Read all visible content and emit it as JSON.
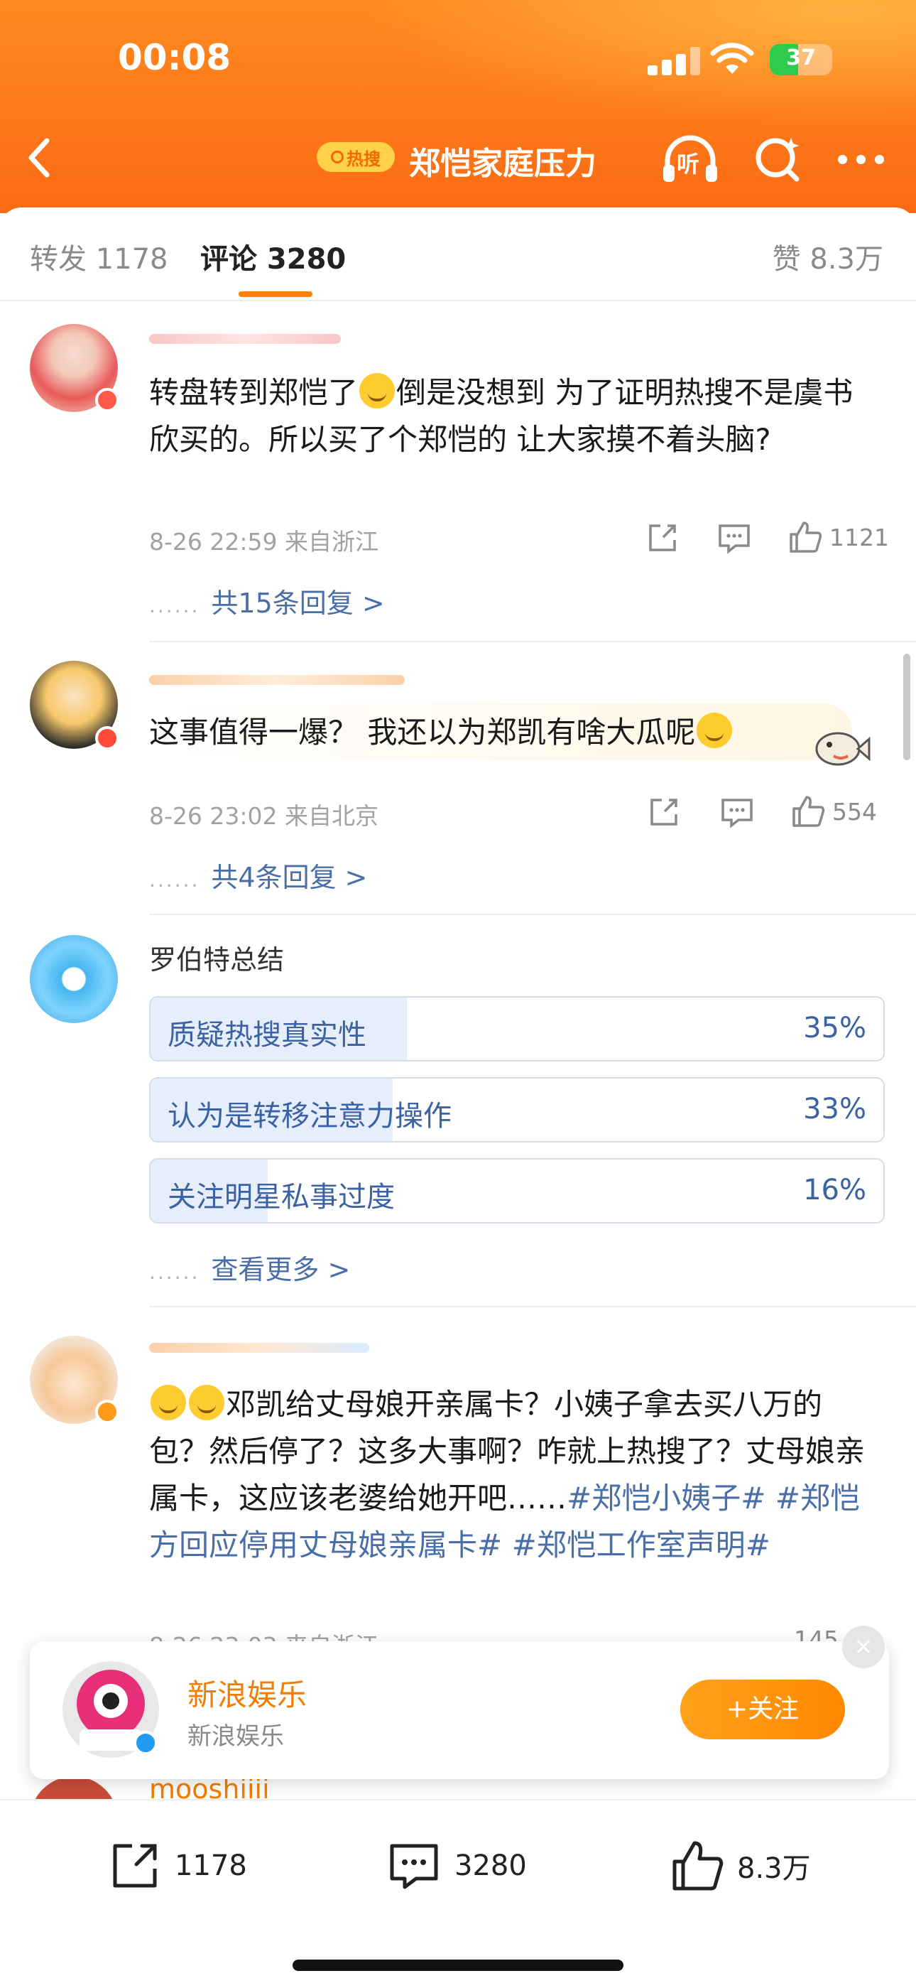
{
  "status_bar": {
    "time": "00:08",
    "battery": "37"
  },
  "header": {
    "hot_label": "热搜",
    "title": "郑恺家庭压力",
    "listen_label": "听"
  },
  "tabs": {
    "repost": "转发 1178",
    "comment": "评论 3280",
    "like": "赞 8.3万"
  },
  "comments": [
    {
      "text": "转盘转到郑恺了",
      "text_after_emoji": "倒是没想到 为了证明热搜不是虞书欣买的。所以买了个郑恺的 让大家摸不着头脑?",
      "meta": "8-26 22:59  来自浙江",
      "likes": "1121",
      "replies": "共15条回复 >"
    },
    {
      "text": "这事值得一爆？ 我还以为郑凯有啥大瓜呢",
      "meta": "8-26 23:02  来自北京",
      "likes": "554",
      "replies": "共4条回复 >"
    }
  ],
  "poll": {
    "name": "罗伯特总结",
    "options": [
      {
        "label": "质疑热搜真实性",
        "percent": "35%",
        "fill": 0.35
      },
      {
        "label": "认为是转移注意力操作",
        "percent": "33%",
        "fill": 0.33
      },
      {
        "label": "关注明星私事过度",
        "percent": "16%",
        "fill": 0.16
      }
    ],
    "more": "查看更多 >"
  },
  "comment3": {
    "text_part1": "邓凯给丈母娘开亲属卡？小姨子拿去买八万的包？然后停了？这多大事啊？咋就上热搜了？丈母娘亲属卡，这应该老婆给她开吧……",
    "hashtag1": "#郑恺小姨子#",
    "hashtag2": "#郑恺方回应停用丈母娘亲属卡#",
    "hashtag3": "#郑恺工作室声明#",
    "meta": "8-26 23:03  来自浙江",
    "likes": "145"
  },
  "next_user": "mooshiiii",
  "float_card": {
    "title": "新浪娱乐",
    "subtitle": "新浪娱乐",
    "follow": "+关注",
    "close": "×"
  },
  "bottom_bar": {
    "repost_count": "1178",
    "comment_count": "3280",
    "like_count": "8.3万"
  },
  "colors": {
    "accent": "#ff8200",
    "link": "#4a6ea8",
    "header": "#fb6a14"
  }
}
